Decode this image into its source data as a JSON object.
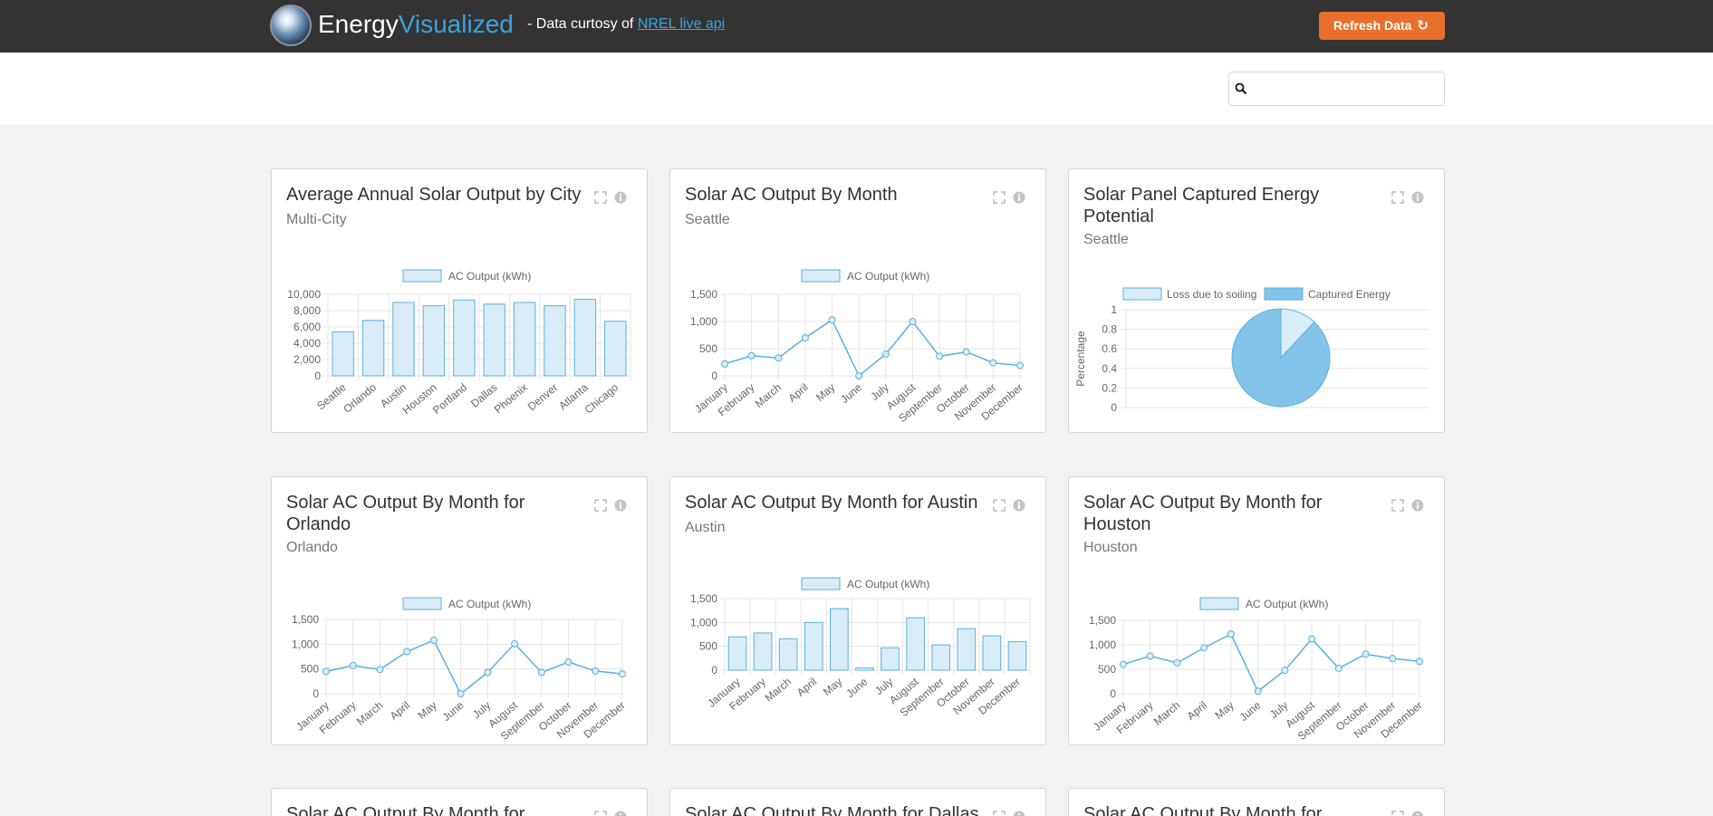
{
  "header": {
    "brand_main": "Energy",
    "brand_accent": "Visualized",
    "tagline_prefix": "- Data curtosy of",
    "tagline_link": "NREL live api",
    "refresh_label": "Refresh Data",
    "refresh_icon": "refresh-icon"
  },
  "search": {
    "placeholder": "",
    "value": "",
    "icon": "search-icon"
  },
  "colors": {
    "topbar": "#333333",
    "accent": "#3aa3dd",
    "button": "#e8702a",
    "series_fill": "#d8edf8",
    "series_line": "#5bb0df",
    "pie_captured": "#82c4ea"
  },
  "cards": [
    {
      "title": "Average Annual Solar Output by City",
      "subtitle": "Multi-City",
      "chart_index": 0
    },
    {
      "title": "Solar AC Output By Month",
      "subtitle": "Seattle",
      "chart_index": 1
    },
    {
      "title": "Solar Panel Captured Energy Potential",
      "subtitle": "Seattle",
      "chart_index": 2
    },
    {
      "title": "Solar AC Output By Month for Orlando",
      "subtitle": "Orlando",
      "chart_index": 3
    },
    {
      "title": "Solar AC Output By Month for Austin",
      "subtitle": "Austin",
      "chart_index": 4
    },
    {
      "title": "Solar AC Output By Month for Houston",
      "subtitle": "Houston",
      "chart_index": 5
    },
    {
      "title": "Solar AC Output By Month for",
      "subtitle": "",
      "chart_index": null
    },
    {
      "title": "Solar AC Output By Month for Dallas",
      "subtitle": "",
      "chart_index": null
    },
    {
      "title": "Solar AC Output By Month for",
      "subtitle": "",
      "chart_index": null
    }
  ],
  "chart_data": [
    {
      "type": "bar",
      "categories": [
        "Seattle",
        "Orlando",
        "Austin",
        "Houston",
        "Portland",
        "Dallas",
        "Phoenix",
        "Denver",
        "Atlanta",
        "Chicago"
      ],
      "series": [
        {
          "name": "AC Output (kWh)",
          "values": [
            5400,
            6800,
            9000,
            8600,
            9300,
            8800,
            9000,
            8600,
            9400,
            6700
          ]
        }
      ],
      "yticks": [
        "10,000",
        "8,000",
        "6,000",
        "4,000",
        "2,000",
        "0"
      ],
      "ylim": [
        0,
        10000
      ],
      "legend": "top"
    },
    {
      "type": "line",
      "categories": [
        "January",
        "February",
        "March",
        "April",
        "May",
        "June",
        "July",
        "August",
        "September",
        "October",
        "November",
        "December"
      ],
      "series": [
        {
          "name": "AC Output (kWh)",
          "values": [
            220,
            370,
            330,
            700,
            1030,
            0,
            400,
            1000,
            360,
            440,
            240,
            190
          ]
        }
      ],
      "yticks": [
        "1,500",
        "1,000",
        "500",
        "0"
      ],
      "ylim": [
        0,
        1500
      ],
      "legend": "top"
    },
    {
      "type": "pie",
      "categories": [
        "Loss due to soiling",
        "Captured Energy"
      ],
      "values": [
        0.12,
        0.88
      ],
      "ylabel": "Percentage",
      "yticks": [
        "1",
        "0.8",
        "0.6",
        "0.4",
        "0.2",
        "0"
      ],
      "legend": "top"
    },
    {
      "type": "line",
      "categories": [
        "January",
        "February",
        "March",
        "April",
        "May",
        "June",
        "July",
        "August",
        "September",
        "October",
        "November",
        "December"
      ],
      "series": [
        {
          "name": "AC Output (kWh)",
          "values": [
            450,
            570,
            490,
            850,
            1080,
            0,
            430,
            1010,
            430,
            640,
            460,
            400
          ]
        }
      ],
      "yticks": [
        "1,500",
        "1,000",
        "500",
        "0"
      ],
      "ylim": [
        0,
        1500
      ],
      "legend": "top"
    },
    {
      "type": "bar",
      "categories": [
        "January",
        "February",
        "March",
        "April",
        "May",
        "June",
        "July",
        "August",
        "September",
        "October",
        "November",
        "December"
      ],
      "series": [
        {
          "name": "AC Output (kWh)",
          "values": [
            700,
            780,
            660,
            1000,
            1290,
            50,
            470,
            1100,
            530,
            870,
            720,
            600
          ]
        }
      ],
      "yticks": [
        "1,500",
        "1,000",
        "500",
        "0"
      ],
      "ylim": [
        0,
        1500
      ],
      "legend": "top"
    },
    {
      "type": "line",
      "categories": [
        "January",
        "February",
        "March",
        "April",
        "May",
        "June",
        "July",
        "August",
        "September",
        "October",
        "November",
        "December"
      ],
      "series": [
        {
          "name": "AC Output (kWh)",
          "values": [
            600,
            770,
            630,
            940,
            1220,
            50,
            480,
            1120,
            520,
            810,
            720,
            660
          ]
        }
      ],
      "yticks": [
        "1,500",
        "1,000",
        "500",
        "0"
      ],
      "ylim": [
        0,
        1500
      ],
      "legend": "top"
    }
  ]
}
